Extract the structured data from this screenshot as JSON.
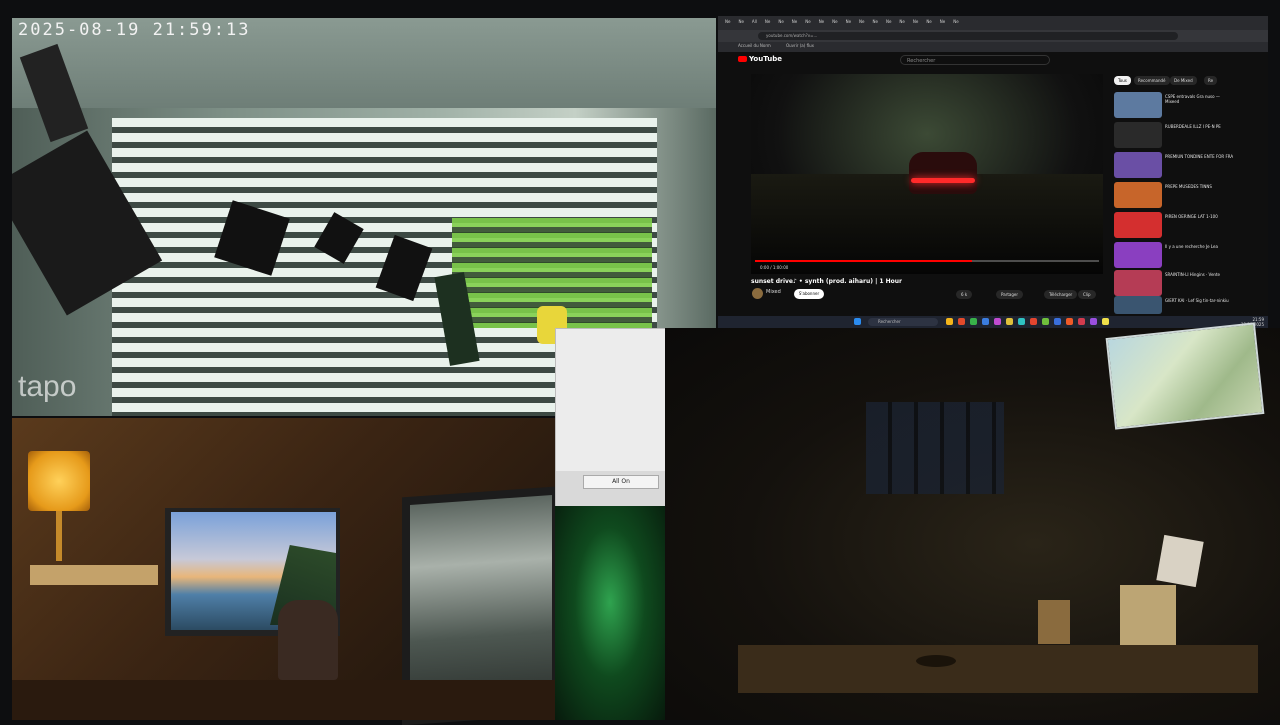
{
  "camera": {
    "timestamp": "2025-08-19 21:59:13",
    "watermark": "tapo"
  },
  "browser": {
    "tabs": [
      "Ne",
      "Ne",
      "All",
      "Ne",
      "Ne",
      "Ne",
      "Ne",
      "Ne",
      "Ne",
      "Ne",
      "Ne",
      "Ne",
      "Ne",
      "Ne",
      "Ne",
      "Ne",
      "Ne",
      "Ne"
    ],
    "url": "youtube.com/watch?v=...",
    "bookmarks": [
      "Accueil du Norm",
      "Ouvrir (a) flux"
    ],
    "youtube": {
      "logo": "YouTube",
      "search_placeholder": "Rechercher",
      "video_title": "sunset drive♪ • synth (prod. aiharu) | 1 Hour",
      "channel": "Mixed",
      "subscribe": "S'abonner",
      "actions": [
        "6 k",
        "Partager",
        "Télécharger",
        "Clip"
      ],
      "chips": [
        "Tous",
        "Recommandé",
        "De Mixed",
        "Re"
      ],
      "time": "0:00 / 1:00:00",
      "recommendations": [
        {
          "title": "CSPE entravals Gra nuso — Mixeed",
          "meta": "42 k vues",
          "color": "#5d7aa0"
        },
        {
          "title": "RUBERDEALE ILLZ I PE-N PE",
          "meta": "Mixed",
          "color": "#2a2a2a"
        },
        {
          "title": "PREMIUN TONDINE ENTE FOR FRA",
          "meta": "Mixeed",
          "color": "#6a4fa5"
        },
        {
          "title": "PREPE MUSEDES TINNS",
          "meta": "Mixeed",
          "color": "#c7652a"
        },
        {
          "title": "PIREN OERINGE LAT 1-100",
          "meta": "Mixeed",
          "color": "#d42f2f"
        },
        {
          "title": "Il y a une recherche Je Lea",
          "meta": "Mixeed",
          "color": "#8a3fc0"
        },
        {
          "title": "SRAINTIN-LI Hingins · Vente",
          "meta": "Mixeed",
          "color": "#b53c55"
        },
        {
          "title": "GIERT KAI · Lef Sig tin-tar-ninkiu",
          "meta": "Mixeed",
          "color": "#3a5570"
        }
      ]
    },
    "taskbar": {
      "search": "Rechercher",
      "clock": "21:59",
      "date": "19/08/2025"
    }
  },
  "dialog": {
    "button": "All On"
  }
}
